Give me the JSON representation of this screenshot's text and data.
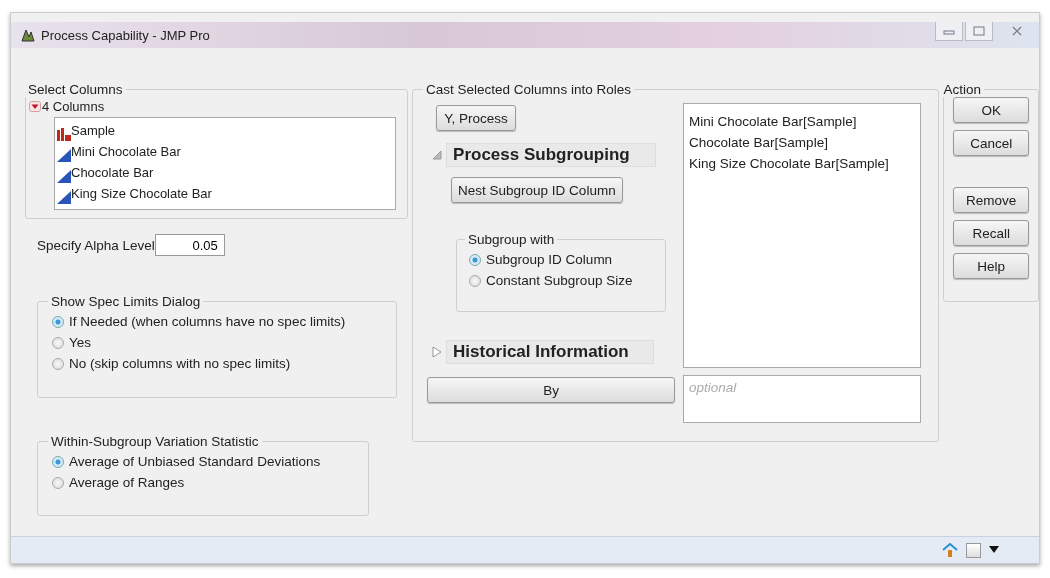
{
  "window": {
    "title": "Process Capability - JMP Pro"
  },
  "select_columns": {
    "label": "Select Columns",
    "count_label": "4 Columns",
    "expanded": true,
    "columns": [
      {
        "name": "Sample",
        "kind": "nominal"
      },
      {
        "name": "Mini Chocolate Bar",
        "kind": "continuous"
      },
      {
        "name": "Chocolate Bar",
        "kind": "continuous"
      },
      {
        "name": "King Size Chocolate Bar",
        "kind": "continuous"
      }
    ]
  },
  "alpha": {
    "label": "Specify Alpha Level",
    "value": "0.05"
  },
  "spec_limits": {
    "label": "Show Spec Limits Dialog",
    "options": [
      {
        "label": "If Needed (when columns have no spec limits)",
        "selected": true
      },
      {
        "label": "Yes",
        "selected": false
      },
      {
        "label": "No (skip columns with no spec limits)",
        "selected": false
      }
    ]
  },
  "variation": {
    "label": "Within-Subgroup Variation Statistic",
    "options": [
      {
        "label": "Average of Unbiased Standard Deviations",
        "selected": true
      },
      {
        "label": "Average of Ranges",
        "selected": false
      }
    ]
  },
  "roles": {
    "label": "Cast Selected Columns into Roles",
    "y_button": "Y, Process",
    "assigned": [
      "Mini Chocolate Bar[Sample]",
      "Chocolate Bar[Sample]",
      "King Size Chocolate Bar[Sample]"
    ],
    "process_subgrouping": {
      "title": "Process Subgrouping",
      "expanded": true,
      "nest_button": "Nest Subgroup ID Column",
      "subgroup_with": {
        "label": "Subgroup with",
        "options": [
          {
            "label": "Subgroup ID Column",
            "selected": true
          },
          {
            "label": "Constant Subgroup Size",
            "selected": false
          }
        ]
      }
    },
    "historical": {
      "title": "Historical Information",
      "expanded": false
    },
    "by_button": "By",
    "by_field": {
      "placeholder": "optional"
    }
  },
  "action": {
    "label": "Action",
    "buttons": [
      "OK",
      "Cancel",
      "Remove",
      "Recall",
      "Help"
    ]
  },
  "status_bar": {
    "checked": false
  }
}
